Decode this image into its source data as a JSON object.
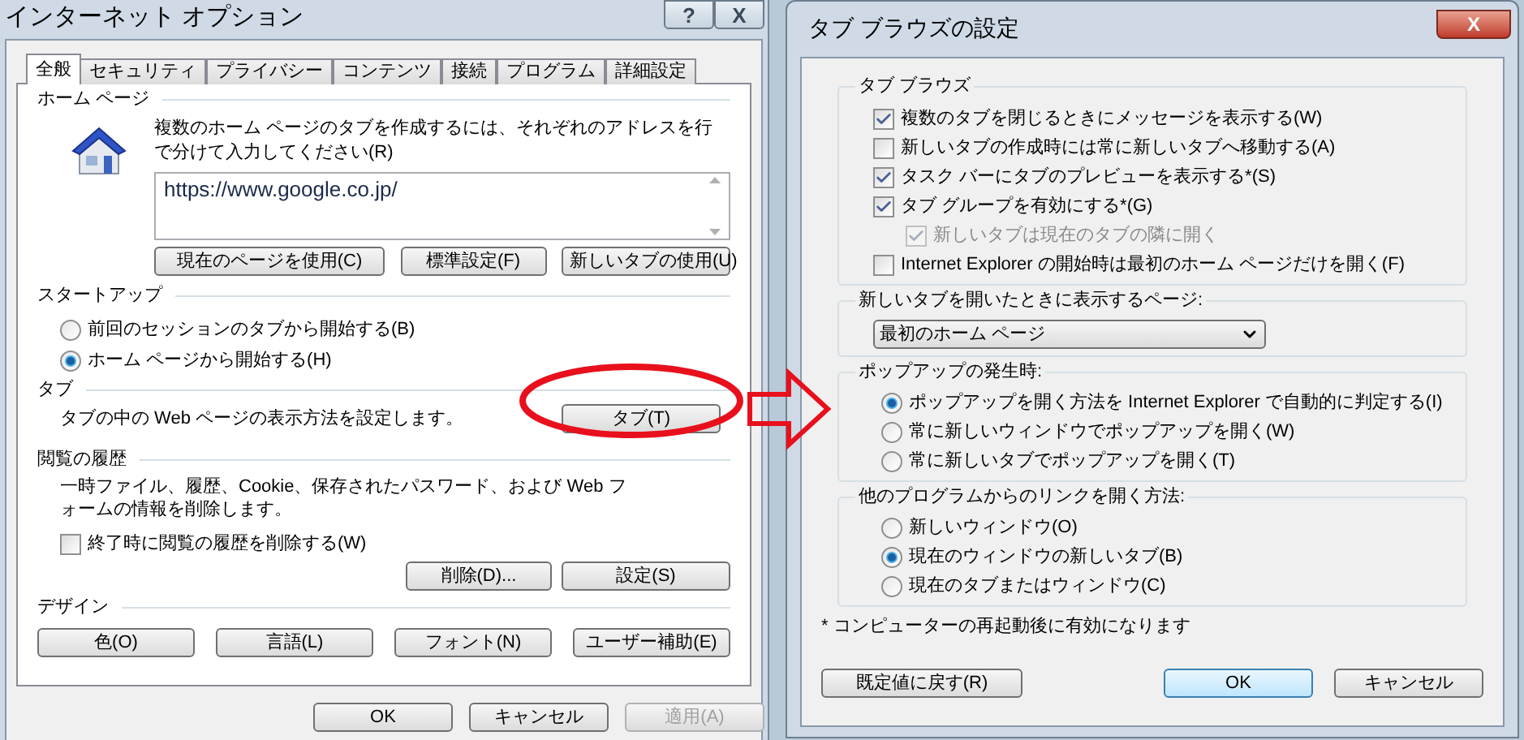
{
  "internet_options": {
    "title": "インターネット オプション",
    "title_buttons": [
      "?",
      "X"
    ],
    "tabs": [
      {
        "label": "全般",
        "selected": true
      },
      {
        "label": "セキュリティ",
        "selected": false
      },
      {
        "label": "プライバシー",
        "selected": false
      },
      {
        "label": "コンテンツ",
        "selected": false
      },
      {
        "label": "接続",
        "selected": false
      },
      {
        "label": "プログラム",
        "selected": false
      },
      {
        "label": "詳細設定",
        "selected": false
      }
    ],
    "home_page": {
      "heading": "ホーム ページ",
      "description": "複数のホーム ページのタブを作成するには、それぞれのアドレスを行で分けて入力してください(R)",
      "url": "https://www.google.co.jp/",
      "buttons": [
        "現在のページを使用(C)",
        "標準設定(F)",
        "新しいタブの使用(U)"
      ]
    },
    "startup": {
      "heading": "スタートアップ",
      "options": [
        {
          "label": "前回のセッションのタブから開始する(B)",
          "selected": false
        },
        {
          "label": "ホーム ページから開始する(H)",
          "selected": true
        }
      ]
    },
    "tabs_section": {
      "heading": "タブ",
      "description": "タブの中の Web ページの表示方法を設定します。",
      "button": "タブ(T)"
    },
    "history": {
      "heading": "閲覧の履歴",
      "description": "一時ファイル、履歴、Cookie、保存されたパスワード、および Web フォームの情報を削除します。",
      "checkbox": {
        "label": "終了時に閲覧の履歴を削除する(W)",
        "checked": false
      },
      "buttons": [
        "削除(D)...",
        "設定(S)"
      ]
    },
    "design": {
      "heading": "デザイン",
      "buttons": [
        "色(O)",
        "言語(L)",
        "フォント(N)",
        "ユーザー補助(E)"
      ]
    },
    "footer_buttons": [
      {
        "label": "OK",
        "disabled": false
      },
      {
        "label": "キャンセル",
        "disabled": false
      },
      {
        "label": "適用(A)",
        "disabled": true
      }
    ]
  },
  "tab_settings": {
    "title": "タブ ブラウズの設定",
    "close": "X",
    "tab_browsing": {
      "heading": "タブ ブラウズ",
      "options": [
        {
          "label": "複数のタブを閉じるときにメッセージを表示する(W)",
          "checked": true,
          "disabled": false
        },
        {
          "label": "新しいタブの作成時には常に新しいタブへ移動する(A)",
          "checked": false,
          "disabled": false
        },
        {
          "label": "タスク バーにタブのプレビューを表示する*(S)",
          "checked": true,
          "disabled": false
        },
        {
          "label": "タブ グループを有効にする*(G)",
          "checked": true,
          "disabled": false,
          "children": [
            {
              "label": "新しいタブは現在のタブの隣に開く",
              "checked": true,
              "disabled": true
            }
          ]
        },
        {
          "label": "Internet Explorer の開始時は最初のホーム ページだけを開く(F)",
          "checked": false,
          "disabled": false
        }
      ]
    },
    "new_tab_page": {
      "heading": "新しいタブを開いたときに表示するページ:",
      "value": "最初のホーム ページ"
    },
    "popups": {
      "heading": "ポップアップの発生時:",
      "options": [
        {
          "label": "ポップアップを開く方法を Internet Explorer で自動的に判定する(I)",
          "selected": true
        },
        {
          "label": "常に新しいウィンドウでポップアップを開く(W)",
          "selected": false
        },
        {
          "label": "常に新しいタブでポップアップを開く(T)",
          "selected": false
        }
      ]
    },
    "links": {
      "heading": "他のプログラムからのリンクを開く方法:",
      "options": [
        {
          "label": "新しいウィンドウ(O)",
          "selected": false
        },
        {
          "label": "現在のウィンドウの新しいタブ(B)",
          "selected": true
        },
        {
          "label": "現在のタブまたはウィンドウ(C)",
          "selected": false
        }
      ]
    },
    "note": "* コンピューターの再起動後に有効になります",
    "buttons": [
      {
        "label": "既定値に戻す(R)",
        "default": false
      },
      {
        "label": "OK",
        "default": true
      },
      {
        "label": "キャンセル",
        "default": false
      }
    ]
  }
}
